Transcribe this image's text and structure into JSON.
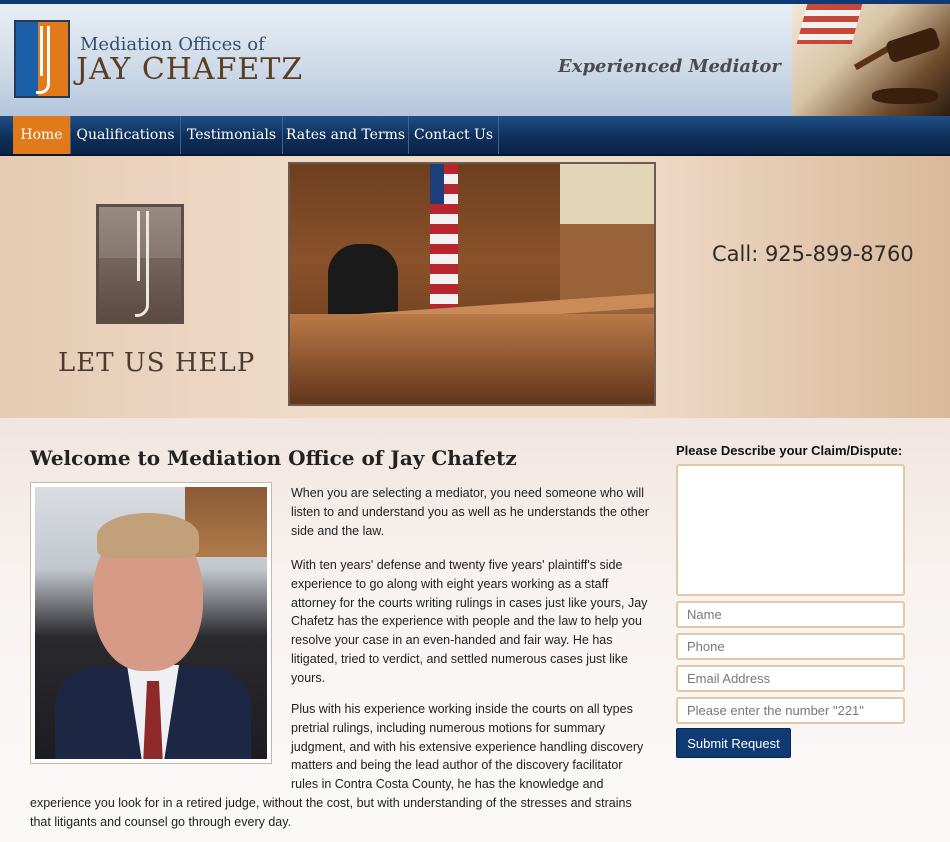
{
  "header": {
    "brand_small": "Mediation Offices of",
    "brand_big": "JAY CHAFETZ",
    "tagline": "Experienced Mediator"
  },
  "nav": {
    "items": [
      {
        "label": "Home",
        "active": true
      },
      {
        "label": "Qualifications",
        "active": false
      },
      {
        "label": "Testimonials",
        "active": false
      },
      {
        "label": "Rates and Terms",
        "active": false
      },
      {
        "label": "Contact Us",
        "active": false
      }
    ]
  },
  "banner": {
    "slogan": "LET US HELP",
    "call": "Call: 925-899-8760"
  },
  "main": {
    "title": "Welcome to Mediation Office of Jay Chafetz",
    "p1": "When you are selecting a mediator, you need someone who will listen to and understand you as well as he understands the other side and the law.",
    "p2": "With ten years' defense and twenty five years' plaintiff's side experience to go along with eight years working as a staff attorney for the courts writing rulings in cases just like yours, Jay Chafetz has the experience with people and the law to help you resolve your case in an even-handed and fair way.  He has litigated, tried to verdict, and settled numerous cases just like yours.",
    "p3_start": "Plus with his experience working inside the courts on all types pretrial rulings, including numerous motions for summary judgment, and with his extensive experience handling discovery matters and being the lead author of the discovery facilitator rules in Contra Costa County, he has the knowledge and",
    "p3_end": "experience you look for in a retired judge, without the cost, but with understanding of the stresses and strains that litigants and counsel go through every day."
  },
  "form": {
    "label": "Please Describe your Claim/Dispute:",
    "name_placeholder": "Name",
    "phone_placeholder": "Phone",
    "email_placeholder": "Email Address",
    "captcha_placeholder": "Please enter the number \"221\"",
    "submit_label": "Submit Request"
  },
  "colors": {
    "accent_orange": "#e07a1a",
    "nav_navy": "#0e2f5a",
    "button_navy": "#103a73"
  }
}
